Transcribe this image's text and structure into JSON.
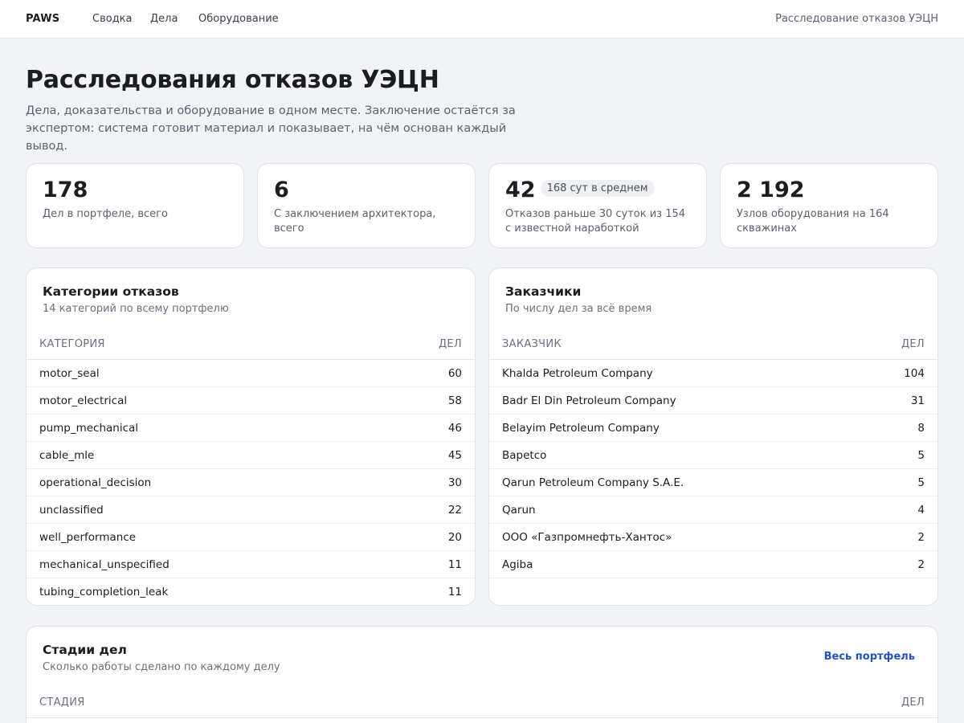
{
  "nav": {
    "brand": "PAWS",
    "items": [
      "Сводка",
      "Дела",
      "Оборудование"
    ],
    "right_text": "Расследование отказов УЭЦН"
  },
  "header": {
    "title": "Расследования отказов УЭЦН",
    "description": "Дела, доказательства и оборудование в одном месте. Заключение остаётся за экспертом: система готовит материал и показывает, на чём основан каждый вывод."
  },
  "kpis": [
    {
      "value": "178",
      "badge": "",
      "label": "Дел в портфеле, всего"
    },
    {
      "value": "6",
      "badge": "",
      "label": "С заключением архитектора, всего"
    },
    {
      "value": "42",
      "badge": "168 сут в среднем",
      "label": "Отказов раньше 30 суток из 154 с известной наработкой"
    },
    {
      "value": "2 192",
      "badge": "",
      "label": "Узлов оборудования на 164 скважинах"
    }
  ],
  "categories": {
    "title": "Категории отказов",
    "subtitle": "14 категорий по всему портфелю",
    "col_name": "Категория",
    "col_count": "Дел",
    "rows": [
      {
        "name": "motor_seal",
        "count": "60"
      },
      {
        "name": "motor_electrical",
        "count": "58"
      },
      {
        "name": "pump_mechanical",
        "count": "46"
      },
      {
        "name": "cable_mle",
        "count": "45"
      },
      {
        "name": "operational_decision",
        "count": "30"
      },
      {
        "name": "unclassified",
        "count": "22"
      },
      {
        "name": "well_performance",
        "count": "20"
      },
      {
        "name": "mechanical_unspecified",
        "count": "11"
      },
      {
        "name": "tubing_completion_leak",
        "count": "11"
      }
    ]
  },
  "customers": {
    "title": "Заказчики",
    "subtitle": "По числу дел за всё время",
    "col_name": "Заказчик",
    "col_count": "Дел",
    "rows": [
      {
        "name": "Khalda Petroleum Company",
        "count": "104"
      },
      {
        "name": "Badr El Din Petroleum Company",
        "count": "31"
      },
      {
        "name": "Belayim Petroleum Company",
        "count": "8"
      },
      {
        "name": "Bapetco",
        "count": "5"
      },
      {
        "name": "Qarun Petroleum Company S.A.E.",
        "count": "5"
      },
      {
        "name": "Qarun",
        "count": "4"
      },
      {
        "name": "ООО «Газпромнефть-Хантос»",
        "count": "2"
      },
      {
        "name": "Agiba",
        "count": "2"
      }
    ]
  },
  "stages": {
    "title": "Стадии дел",
    "subtitle": "Сколько работы сделано по каждому делу",
    "link": "Весь портфель",
    "col_name": "Стадия",
    "col_count": "Дел"
  }
}
